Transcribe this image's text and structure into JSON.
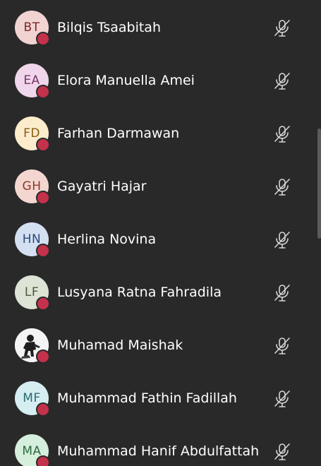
{
  "participants": [
    {
      "initials": "BT",
      "name": "Bilqis Tsaabitah",
      "avatar_bg": "#f1d3d2",
      "avatar_fg": "#7a2626",
      "status": "busy",
      "mic": "muted-mic-icon"
    },
    {
      "initials": "EA",
      "name": "Elora Manuella Amei",
      "avatar_bg": "#f0d6ea",
      "avatar_fg": "#7a3468",
      "status": "busy",
      "mic": "muted-mic-icon"
    },
    {
      "initials": "FD",
      "name": "Farhan Darmawan",
      "avatar_bg": "#fbeccb",
      "avatar_fg": "#8a5b14",
      "status": "busy",
      "mic": "muted-mic-icon"
    },
    {
      "initials": "GH",
      "name": "Gayatri Hajar",
      "avatar_bg": "#f4d6d0",
      "avatar_fg": "#8a3a2a",
      "status": "busy",
      "mic": "muted-mic-icon"
    },
    {
      "initials": "HN",
      "name": "Herlina Novina",
      "avatar_bg": "#d4e0f2",
      "avatar_fg": "#2c4a7a",
      "status": "busy",
      "mic": "muted-mic-icon"
    },
    {
      "initials": "LF",
      "name": "Lusyana Ratna Fahradila",
      "avatar_bg": "#dde4d6",
      "avatar_fg": "#4a5a3e",
      "status": "busy",
      "mic": "muted-mic-icon"
    },
    {
      "initials": "",
      "name": "Muhamad Maishak",
      "avatar_bg": "#f4f4f4",
      "avatar_fg": "#222222",
      "status": "busy",
      "mic": "muted-mic-icon",
      "photo": true
    },
    {
      "initials": "MF",
      "name": "Muhammad Fathin Fadillah",
      "avatar_bg": "#d6eef2",
      "avatar_fg": "#2a6a72",
      "status": "busy",
      "mic": "muted-mic-icon"
    },
    {
      "initials": "MA",
      "name": "Muhammad Hanif Abdulfattah",
      "avatar_bg": "#d6eedc",
      "avatar_fg": "#2e6a40",
      "status": "busy",
      "mic": "muted-mic-icon"
    }
  ],
  "colors": {
    "background": "#292929",
    "text": "#ffffff",
    "status_busy": "#c4314b",
    "mic_icon": "#d6d6d6",
    "scrollbar": "#5b5b5b"
  }
}
